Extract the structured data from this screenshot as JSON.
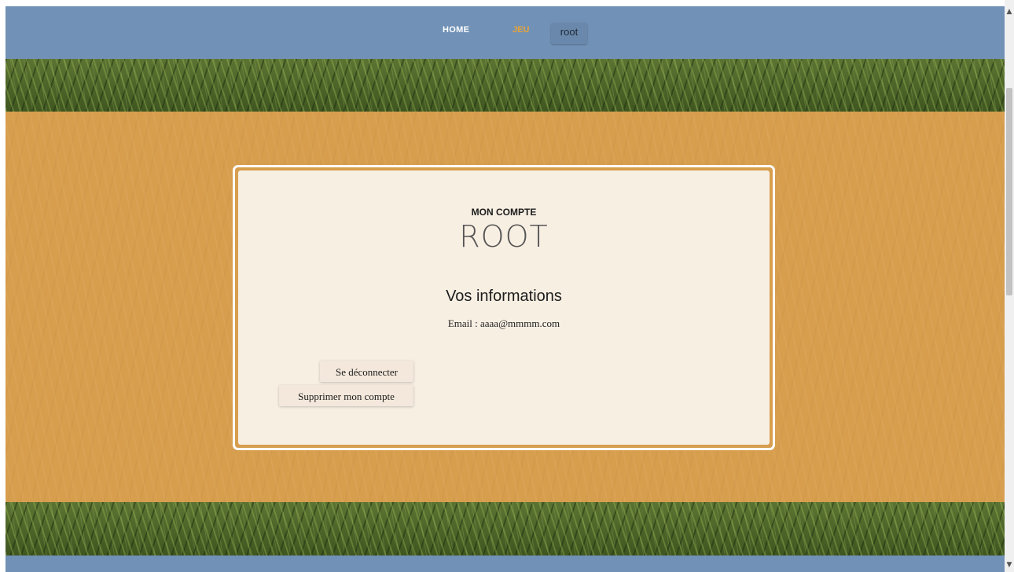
{
  "nav": {
    "home": "HOME",
    "jeu": "JEU",
    "user": "root"
  },
  "card": {
    "subtitle": "MON COMPTE",
    "title": "ROOT",
    "info_heading": "Vos informations",
    "email_line": "Email : aaaa@mmmm.com",
    "logout_label": "Se déconnecter",
    "delete_label": "Supprimer mon compte"
  },
  "colors": {
    "nav_bg": "#7191b6",
    "accent": "#e8a33a",
    "panel_bg": "#d79e4e",
    "card_bg": "#f8efe3"
  },
  "scrollbar": {
    "up_icon": "chevron-up-icon",
    "down_icon": "chevron-down-icon"
  }
}
